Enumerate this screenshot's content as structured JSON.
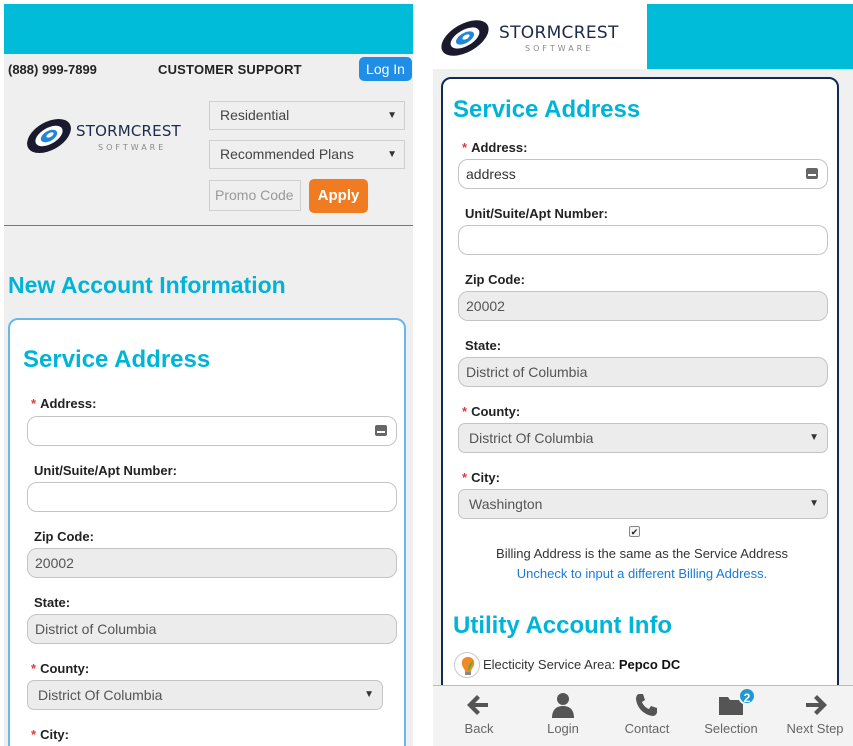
{
  "header": {
    "phone": "(888) 999-7899",
    "support": "CUSTOMER SUPPORT",
    "login_label": "Log In"
  },
  "logo": {
    "wordmark_top": "STORMCREST",
    "wordmark_bottom": "SOFTWARE"
  },
  "filters": {
    "residential": "Residential",
    "plans": "Recommended Plans",
    "promo_placeholder": "Promo Code",
    "apply_label": "Apply"
  },
  "page": {
    "heading": "New Account Information"
  },
  "service": {
    "title": "Service Address",
    "address_label": "Address:",
    "address_value": "address",
    "unit_label": "Unit/Suite/Apt Number:",
    "zip_label": "Zip Code:",
    "zip_value": "20002",
    "state_label": "State:",
    "state_value": "District of Columbia",
    "county_label": "County:",
    "county_value": "District Of Columbia",
    "city_label": "City:",
    "city_value": "Washington",
    "required_mark": "*"
  },
  "billing": {
    "same_text": "Billing Address is the same as the Service Address",
    "uncheck_link": "Uncheck to input a different Billing Address.",
    "checkmark": "✔"
  },
  "utility": {
    "title": "Utility Account Info",
    "area_label": "Electicity Service Area:",
    "area_value": "Pepco DC"
  },
  "nav": {
    "back": "Back",
    "login": "Login",
    "contact": "Contact",
    "selection": "Selection",
    "selection_badge": "2",
    "next": "Next Step"
  },
  "colors": {
    "brand_cyan": "#00bcd8",
    "heading_cyan": "#00b4d8",
    "apply_orange": "#f07b20",
    "login_blue": "#1e8ee6",
    "link_blue": "#1a7bd6",
    "required_red": "#e03a3a",
    "card_border_left": "#6ab7ee",
    "card_border_right": "#0f2b54"
  },
  "icons": {
    "logo": "storm-swirl-icon",
    "keyboard": "keyboard-icon",
    "back": "arrow-left-icon",
    "login": "user-icon",
    "contact": "phone-icon",
    "selection": "folder-icon",
    "next": "arrow-right-icon",
    "electricity": "bulb-leaf-icon"
  }
}
